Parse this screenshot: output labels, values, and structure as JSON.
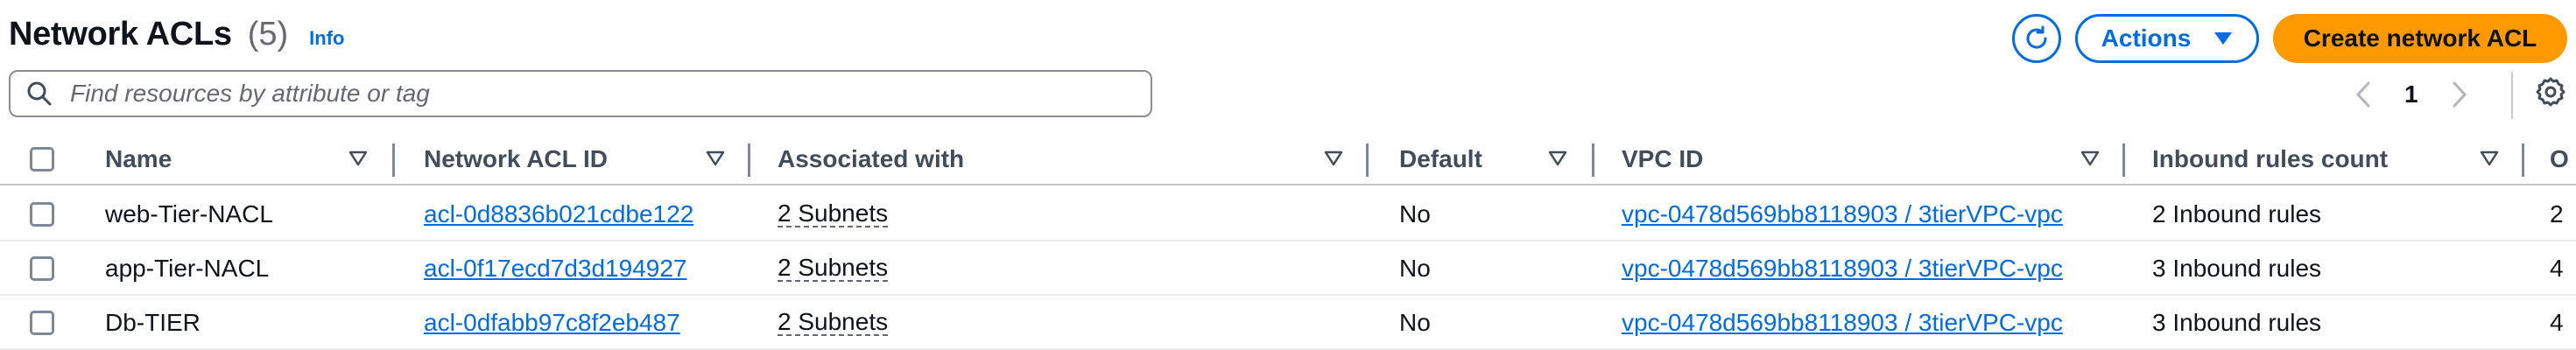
{
  "header": {
    "title": "Network ACLs",
    "count": "(5)",
    "info": "Info",
    "actions_label": "Actions",
    "create_label": "Create network ACL"
  },
  "search": {
    "placeholder": "Find resources by attribute or tag"
  },
  "pagination": {
    "current_page": "1"
  },
  "table": {
    "columns": [
      "Name",
      "Network ACL ID",
      "Associated with",
      "Default",
      "VPC ID",
      "Inbound rules count",
      "O"
    ],
    "rows": [
      {
        "name": "web-Tier-NACL",
        "acl_id": "acl-0d8836b021cdbe122",
        "associated": "2 Subnets",
        "default": "No",
        "vpc_id": "vpc-0478d569bb8118903 / 3tierVPC-vpc",
        "inbound": "2 Inbound rules",
        "outbound": "2"
      },
      {
        "name": "app-Tier-NACL",
        "acl_id": "acl-0f17ecd7d3d194927",
        "associated": "2 Subnets",
        "default": "No",
        "vpc_id": "vpc-0478d569bb8118903 / 3tierVPC-vpc",
        "inbound": "3 Inbound rules",
        "outbound": "4"
      },
      {
        "name": "Db-TIER",
        "acl_id": "acl-0dfabb97c8f2eb487",
        "associated": "2 Subnets",
        "default": "No",
        "vpc_id": "vpc-0478d569bb8118903 / 3tierVPC-vpc",
        "inbound": "3 Inbound rules",
        "outbound": "4"
      }
    ]
  },
  "colors": {
    "link": "#006ce0",
    "primary": "#ff9900",
    "text": "#0f141a",
    "muted": "#656871"
  }
}
